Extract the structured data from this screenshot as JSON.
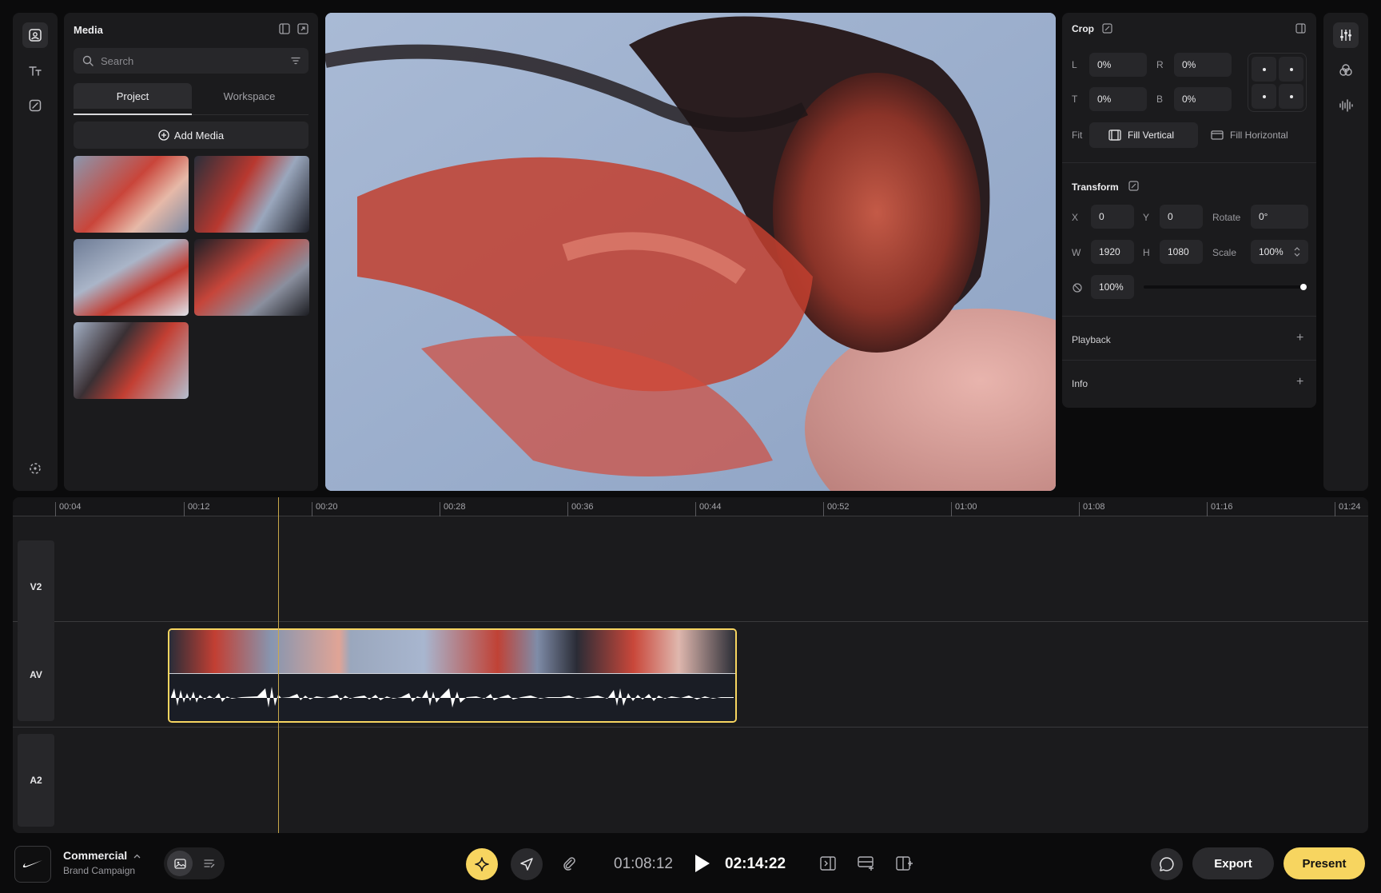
{
  "media_panel": {
    "title": "Media",
    "search_placeholder": "Search",
    "tabs": [
      {
        "label": "Project"
      },
      {
        "label": "Workspace"
      }
    ],
    "add_media_label": "Add Media"
  },
  "crop": {
    "title": "Crop",
    "left_label": "L",
    "left_value": "0%",
    "right_label": "R",
    "right_value": "0%",
    "top_label": "T",
    "top_value": "0%",
    "bottom_label": "B",
    "bottom_value": "0%",
    "fit_label": "Fit",
    "fill_vertical_label": "Fill Vertical",
    "fill_horizontal_label": "Fill Horizontal"
  },
  "transform": {
    "title": "Transform",
    "x_label": "X",
    "x_value": "0",
    "y_label": "Y",
    "y_value": "0",
    "rotate_label": "Rotate",
    "rotate_value": "0°",
    "w_label": "W",
    "w_value": "1920",
    "h_label": "H",
    "h_value": "1080",
    "scale_label": "Scale",
    "scale_value": "100%",
    "opacity_value": "100%",
    "opacity_fraction": 1.0
  },
  "sections": {
    "playback": "Playback",
    "info": "Info"
  },
  "timeline": {
    "ticks": [
      "00:04",
      "00:12",
      "00:20",
      "00:28",
      "00:36",
      "00:44",
      "00:52",
      "01:00",
      "01:08",
      "01:16",
      "01:24"
    ],
    "tracks": [
      {
        "label": "V2"
      },
      {
        "label": "AV"
      },
      {
        "label": "A2"
      }
    ]
  },
  "project": {
    "name": "Commercial",
    "subtitle": "Brand Campaign"
  },
  "playback": {
    "current_time": "01:08:12",
    "total_time": "02:14:22"
  },
  "actions": {
    "export_label": "Export",
    "present_label": "Present"
  },
  "colors": {
    "accent": "#f7d560",
    "panel": "#1b1b1d",
    "background": "#0b0b0c"
  }
}
